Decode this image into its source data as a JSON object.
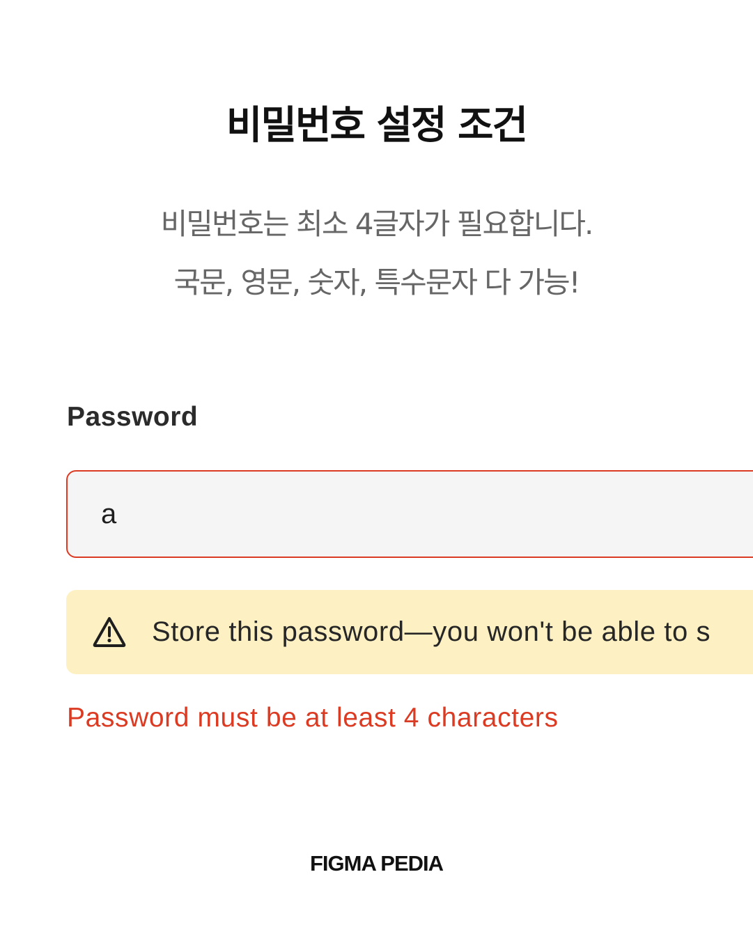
{
  "header": {
    "title": "비밀번호 설정 조건",
    "subtitle_lines": [
      "비밀번호는 최소 4글자가 필요합니다.",
      "국문, 영문, 숫자, 특수문자 다 가능!"
    ]
  },
  "form": {
    "password_label": "Password",
    "password_value": "a",
    "warning": {
      "icon": "warning-triangle-icon",
      "text": "Store this password—you won't be able to s"
    },
    "error_message": "Password must be at least 4 characters"
  },
  "footer": {
    "brand": "FIGMA PEDIA"
  },
  "colors": {
    "error": "#db3b22",
    "warning_background": "#fdf1c4",
    "input_background": "#f5f5f5",
    "title": "#111111",
    "subtitle": "#666666"
  }
}
